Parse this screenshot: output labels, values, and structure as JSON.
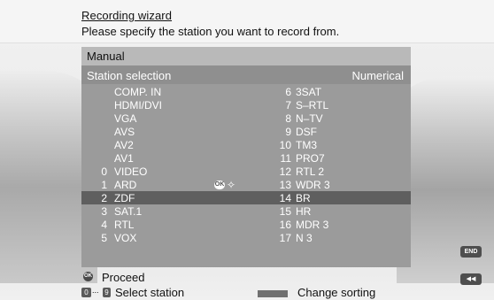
{
  "wizard": {
    "title": "Recording wizard",
    "subtitle": "Please specify the station you want to record from."
  },
  "panel": {
    "mode": "Manual",
    "section_title": "Station selection",
    "sorting_label": "Numerical"
  },
  "channels_left": [
    {
      "num": "",
      "name": "COMP. IN"
    },
    {
      "num": "",
      "name": "HDMI/DVI"
    },
    {
      "num": "",
      "name": "VGA"
    },
    {
      "num": "",
      "name": "AVS"
    },
    {
      "num": "",
      "name": "AV2"
    },
    {
      "num": "",
      "name": "AV1"
    },
    {
      "num": "0",
      "name": "VIDEO"
    },
    {
      "num": "1",
      "name": "ARD"
    },
    {
      "num": "2",
      "name": "ZDF"
    },
    {
      "num": "3",
      "name": "SAT.1"
    },
    {
      "num": "4",
      "name": "RTL"
    },
    {
      "num": "5",
      "name": "VOX"
    }
  ],
  "channels_right": [
    {
      "num": "6",
      "name": "3SAT"
    },
    {
      "num": "7",
      "name": "S–RTL"
    },
    {
      "num": "8",
      "name": "N–TV"
    },
    {
      "num": "9",
      "name": "DSF"
    },
    {
      "num": "10",
      "name": "TM3"
    },
    {
      "num": "11",
      "name": "PRO7"
    },
    {
      "num": "12",
      "name": "RTL 2"
    },
    {
      "num": "13",
      "name": "WDR 3"
    },
    {
      "num": "14",
      "name": "BR"
    },
    {
      "num": "15",
      "name": "HR"
    },
    {
      "num": "16",
      "name": "MDR 3"
    },
    {
      "num": "17",
      "name": "N 3"
    }
  ],
  "selected_channel": {
    "num": "1",
    "name": "ARD"
  },
  "footer": {
    "ok_key": "OK",
    "proceed": "Proceed",
    "key_start": "0",
    "key_end": "9",
    "key_dots": "...",
    "select_station": "Select station",
    "change_sorting": "Change sorting"
  },
  "side_buttons": {
    "end": "END",
    "back": "◀◀"
  },
  "icons": {
    "ok_badge": "ok-badge-icon",
    "navigate": "navigate-arrows-icon",
    "color_key": "grey-key-icon"
  },
  "colors": {
    "panel_bg": "#9b9b9b",
    "header_bg": "#b9b9b9",
    "highlight": "#5f5f5f",
    "text_light": "#ffffff"
  }
}
